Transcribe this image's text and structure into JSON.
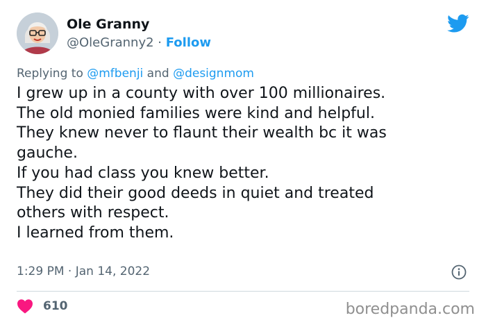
{
  "author": {
    "name": "Ole Granny",
    "handle": "@OleGranny2",
    "separator": " · ",
    "follow_label": "Follow"
  },
  "reply": {
    "prefix": "Replying to ",
    "mention_1": "@mfbenji",
    "joiner": " and ",
    "mention_2": "@designmom"
  },
  "tweet": {
    "lines": [
      "I grew up in a county with over 100 millionaires.",
      "The old monied families were kind and helpful.",
      "They knew never to flaunt their wealth bc it was",
      "gauche.",
      "If you had class you knew better.",
      "They did their good deeds in quiet and treated",
      "others with respect.",
      "I learned from them."
    ],
    "timestamp": "1:29 PM · Jan 14, 2022",
    "likes": "610"
  },
  "watermark": "boredpanda.com",
  "colors": {
    "accent": "#1d9bf0",
    "heart": "#f91880",
    "muted": "#536471"
  },
  "icons": {
    "brand": "twitter-bird-icon",
    "like": "heart-icon",
    "info": "info-icon"
  }
}
